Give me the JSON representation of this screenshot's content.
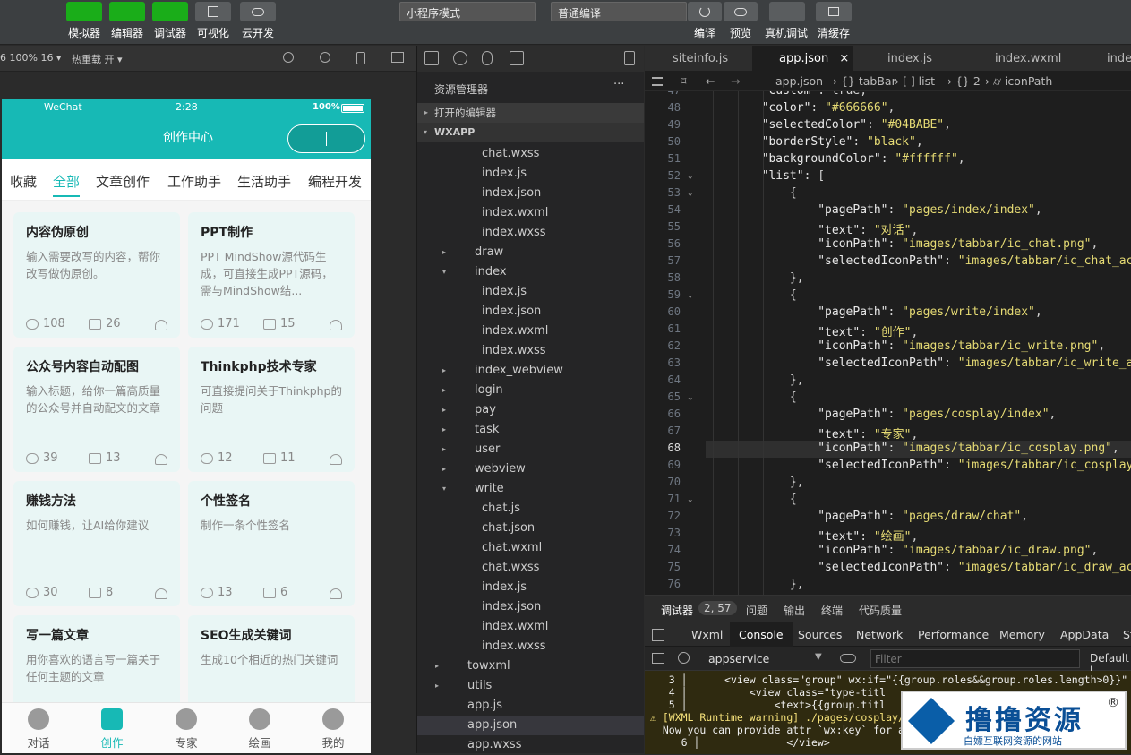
{
  "toolbar": {
    "buttons": [
      "模拟器",
      "编辑器",
      "调试器",
      "可视化",
      "云开发"
    ],
    "mode_select": "小程序模式",
    "compile_select": "普通编译",
    "right_buttons": [
      "编译",
      "预览",
      "真机调试",
      "清缓存"
    ]
  },
  "subbar": {
    "zoom": "6 100% 16 ▾",
    "hotreload": "热重载 开 ▾"
  },
  "phone": {
    "status_left": "WeChat",
    "status_time": "2:28",
    "status_battery": "100%",
    "nav_title": "创作中心",
    "tabs": [
      "收藏",
      "全部",
      "文章创作",
      "工作助手",
      "生活助手",
      "编程开发"
    ],
    "cards": [
      {
        "title": "内容伪原创",
        "desc": "输入需要改写的内容，帮你改写做伪原创。",
        "views": "108",
        "comments": "26"
      },
      {
        "title": "PPT制作",
        "desc": "PPT MindShow源代码生成，可直接生成PPT源码，需与MindShow结...",
        "views": "171",
        "comments": "15"
      },
      {
        "title": "公众号内容自动配图",
        "desc": "输入标题，给你一篇高质量的公众号并自动配文的文章",
        "views": "39",
        "comments": "13"
      },
      {
        "title": "Thinkphp技术专家",
        "desc": "可直接提问关于Thinkphp的问题",
        "views": "12",
        "comments": "11"
      },
      {
        "title": "赚钱方法",
        "desc": "如何赚钱，让AI给你建议",
        "views": "30",
        "comments": "8"
      },
      {
        "title": "个性签名",
        "desc": "制作一条个性签名",
        "views": "13",
        "comments": "6"
      },
      {
        "title": "写一篇文章",
        "desc": "用你喜欢的语言写一篇关于任何主题的文章",
        "views": "",
        "": ""
      },
      {
        "title": "SEO生成关键词",
        "desc": "生成10个相近的热门关键词",
        "views": "",
        "comments": ""
      }
    ],
    "tabbar": [
      "对话",
      "创作",
      "专家",
      "绘画",
      "我的"
    ]
  },
  "explorer": {
    "title": "资源管理器",
    "more": "···",
    "open_editors": "打开的编辑器",
    "root": "WXAPP",
    "items": [
      {
        "label": "chat.wxss",
        "indent": 2
      },
      {
        "label": "index.js",
        "indent": 2
      },
      {
        "label": "index.json",
        "indent": 2
      },
      {
        "label": "index.wxml",
        "indent": 2
      },
      {
        "label": "index.wxss",
        "indent": 2
      },
      {
        "label": "draw",
        "indent": 1,
        "arrow": "▸"
      },
      {
        "label": "index",
        "indent": 1,
        "arrow": "▾"
      },
      {
        "label": "index.js",
        "indent": 2
      },
      {
        "label": "index.json",
        "indent": 2
      },
      {
        "label": "index.wxml",
        "indent": 2
      },
      {
        "label": "index.wxss",
        "indent": 2
      },
      {
        "label": "index_webview",
        "indent": 1,
        "arrow": "▸"
      },
      {
        "label": "login",
        "indent": 1,
        "arrow": "▸"
      },
      {
        "label": "pay",
        "indent": 1,
        "arrow": "▸"
      },
      {
        "label": "task",
        "indent": 1,
        "arrow": "▸"
      },
      {
        "label": "user",
        "indent": 1,
        "arrow": "▸"
      },
      {
        "label": "webview",
        "indent": 1,
        "arrow": "▸"
      },
      {
        "label": "write",
        "indent": 1,
        "arrow": "▾"
      },
      {
        "label": "chat.js",
        "indent": 2
      },
      {
        "label": "chat.json",
        "indent": 2
      },
      {
        "label": "chat.wxml",
        "indent": 2
      },
      {
        "label": "chat.wxss",
        "indent": 2
      },
      {
        "label": "index.js",
        "indent": 2
      },
      {
        "label": "index.json",
        "indent": 2
      },
      {
        "label": "index.wxml",
        "indent": 2
      },
      {
        "label": "index.wxss",
        "indent": 2
      },
      {
        "label": "towxml",
        "indent": 0,
        "arrow": "▸"
      },
      {
        "label": "utils",
        "indent": 0,
        "arrow": "▸"
      },
      {
        "label": "app.js",
        "indent": 0
      },
      {
        "label": "app.json",
        "indent": 0,
        "selected": true
      },
      {
        "label": "app.wxss",
        "indent": 0
      }
    ]
  },
  "editor": {
    "tabs": [
      "siteinfo.js",
      "app.json",
      "index.js",
      "index.wxml",
      "index"
    ],
    "tab_close": "×",
    "breadcrumb": [
      "app.json",
      "› {} tabBar",
      "› [ ] list",
      "› {} 2",
      "› ⌭ iconPath"
    ],
    "lines": [
      {
        "n": "47",
        "t": "        \"custom\": true,"
      },
      {
        "n": "48",
        "t": "        \"color\": \"#666666\","
      },
      {
        "n": "49",
        "t": "        \"selectedColor\": \"#04BABE\","
      },
      {
        "n": "50",
        "t": "        \"borderStyle\": \"black\","
      },
      {
        "n": "51",
        "t": "        \"backgroundColor\": \"#ffffff\","
      },
      {
        "n": "52",
        "t": "        \"list\": ["
      },
      {
        "n": "53",
        "t": "            {"
      },
      {
        "n": "54",
        "t": "                \"pagePath\": \"pages/index/index\","
      },
      {
        "n": "55",
        "t": "                \"text\": \"对话\","
      },
      {
        "n": "56",
        "t": "                \"iconPath\": \"images/tabbar/ic_chat.png\","
      },
      {
        "n": "57",
        "t": "                \"selectedIconPath\": \"images/tabbar/ic_chat_act"
      },
      {
        "n": "58",
        "t": "            },"
      },
      {
        "n": "59",
        "t": "            {"
      },
      {
        "n": "60",
        "t": "                \"pagePath\": \"pages/write/index\","
      },
      {
        "n": "61",
        "t": "                \"text\": \"创作\","
      },
      {
        "n": "62",
        "t": "                \"iconPath\": \"images/tabbar/ic_write.png\","
      },
      {
        "n": "63",
        "t": "                \"selectedIconPath\": \"images/tabbar/ic_write_ac"
      },
      {
        "n": "64",
        "t": "            },"
      },
      {
        "n": "65",
        "t": "            {"
      },
      {
        "n": "66",
        "t": "                \"pagePath\": \"pages/cosplay/index\","
      },
      {
        "n": "67",
        "t": "                \"text\": \"专家\","
      },
      {
        "n": "68",
        "t": "                \"iconPath\": \"images/tabbar/ic_cosplay.png\","
      },
      {
        "n": "69",
        "t": "                \"selectedIconPath\": \"images/tabbar/ic_cosplay_"
      },
      {
        "n": "70",
        "t": "            },"
      },
      {
        "n": "71",
        "t": "            {"
      },
      {
        "n": "72",
        "t": "                \"pagePath\": \"pages/draw/chat\","
      },
      {
        "n": "73",
        "t": "                \"text\": \"绘画\","
      },
      {
        "n": "74",
        "t": "                \"iconPath\": \"images/tabbar/ic_draw.png\","
      },
      {
        "n": "75",
        "t": "                \"selectedIconPath\": \"images/tabbar/ic_draw_act"
      },
      {
        "n": "76",
        "t": "            },"
      }
    ]
  },
  "debugger": {
    "head": [
      "调试器",
      "2, 57",
      "问题",
      "输出",
      "终端",
      "代码质量"
    ],
    "tabs": [
      "Wxml",
      "Console",
      "Sources",
      "Network",
      "Performance",
      "Memory",
      "AppData",
      "St"
    ],
    "context": "appservice",
    "filter_placeholder": "Filter",
    "levels": "Default l",
    "console": [
      "   3 │      <view class=\"group\" wx:if=\"{{group.roles&&group.roles.length>0}}\"",
      "   4 │          <view class=\"type-titl",
      "   5 │              <text>{{group.titl",
      "⚠ [WXML Runtime warning] ./pages/cosplay/i",
      "  Now you can provide attr `wx:key` for a",
      "     6 │              </view>"
    ]
  },
  "watermark": {
    "title": "撸撸资源",
    "sub": "白嫖互联网资源的网站",
    "reg": "®"
  }
}
